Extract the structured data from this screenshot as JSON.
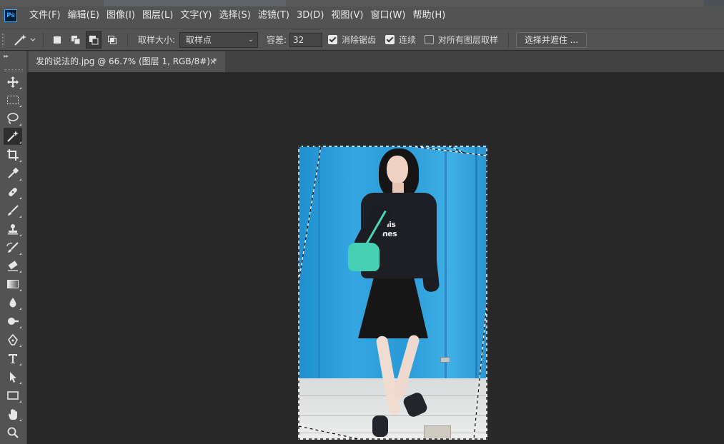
{
  "app": {
    "logo": "Ps"
  },
  "menu": [
    "文件(F)",
    "编辑(E)",
    "图像(I)",
    "图层(L)",
    "文字(Y)",
    "选择(S)",
    "滤镜(T)",
    "3D(D)",
    "视图(V)",
    "窗口(W)",
    "帮助(H)"
  ],
  "options": {
    "sample_size_label": "取样大小:",
    "sample_size_value": "取样点",
    "tolerance_label": "容差:",
    "tolerance_value": "32",
    "anti_alias_label": "消除锯齿",
    "anti_alias_checked": true,
    "contiguous_label": "连续",
    "contiguous_checked": true,
    "sample_all_layers_label": "对所有图层取样",
    "sample_all_layers_checked": false,
    "select_and_mask_label": "选择并遮住 ..."
  },
  "document": {
    "tab_title": "发的说法的.jpg @ 66.7% (图层 1, RGB/8#) *",
    "close_glyph": "×"
  },
  "image_text": {
    "print_line1": "Tennis",
    "print_line2": "Clones"
  },
  "tools": [
    "move-tool",
    "marquee-tool",
    "lasso-tool",
    "magic-wand-tool",
    "crop-tool",
    "eyedropper-tool",
    "healing-brush-tool",
    "brush-tool",
    "clone-stamp-tool",
    "history-brush-tool",
    "eraser-tool",
    "gradient-tool",
    "blur-tool",
    "dodge-tool",
    "pen-tool",
    "type-tool",
    "path-selection-tool",
    "rectangle-tool",
    "hand-tool",
    "zoom-tool"
  ],
  "active_tool": "magic-wand-tool",
  "colors": {
    "ui_panel": "#535353",
    "canvas_bg": "#282828",
    "wall_blue": "#2f9bd6",
    "ps_blue": "#31a8ff"
  }
}
